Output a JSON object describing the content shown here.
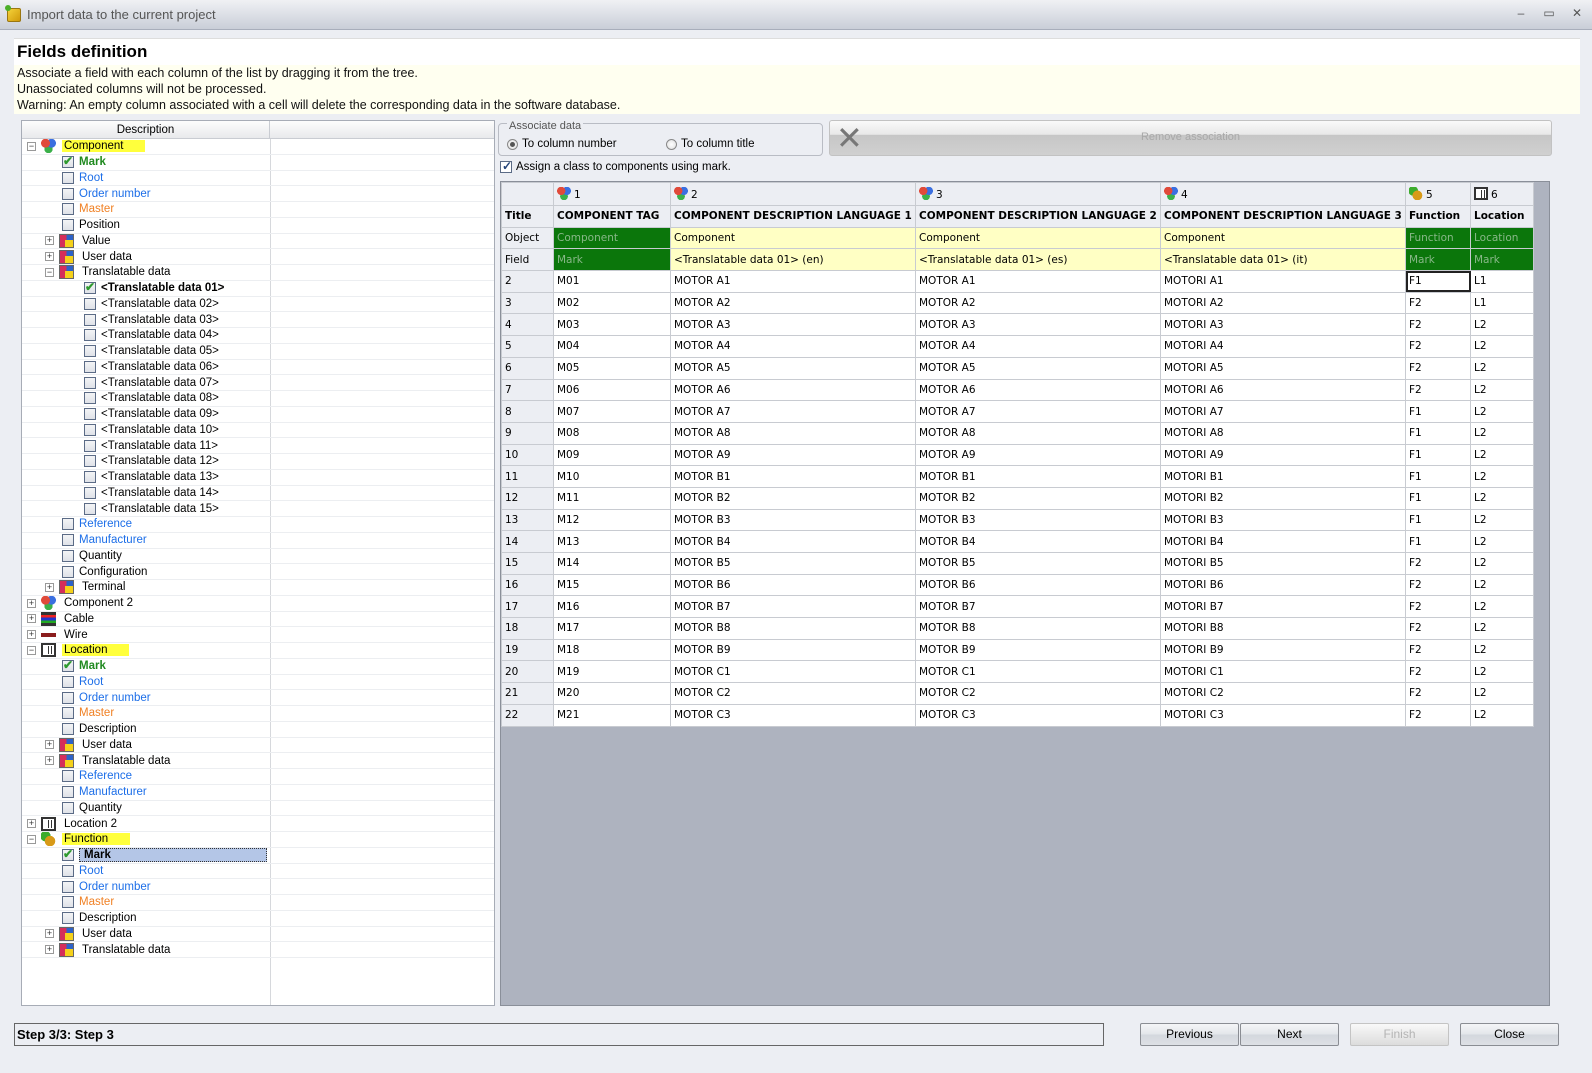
{
  "window": {
    "title": "Import data to the current project",
    "controls": {
      "minimize": "–",
      "maximize": "▭",
      "close": "✕"
    }
  },
  "header": {
    "title": "Fields definition",
    "lines": [
      "Associate a field with each column of the list by dragging it from the tree.",
      "Unassociated columns will not be processed.",
      "Warning: An empty column associated with a cell will delete the corresponding data in the software database."
    ]
  },
  "tree": {
    "column_header": "Description",
    "nodes": [
      {
        "label": "Component",
        "level": 0,
        "icon": "component-icon",
        "expander": "minus",
        "highlight": true
      },
      {
        "label": "Mark",
        "level": 1,
        "checkbox": true,
        "checked": true,
        "style": "greenb"
      },
      {
        "label": "Root",
        "level": 1,
        "checkbox": true,
        "style": "blue"
      },
      {
        "label": "Order number",
        "level": 1,
        "checkbox": true,
        "style": "blue"
      },
      {
        "label": "Master",
        "level": 1,
        "checkbox": true,
        "style": "orange"
      },
      {
        "label": "Position",
        "level": 1,
        "checkbox": true
      },
      {
        "label": "Value",
        "level": 1,
        "icon": "data-icon",
        "expander": "plus"
      },
      {
        "label": "User data",
        "level": 1,
        "icon": "data-icon",
        "expander": "plus"
      },
      {
        "label": "Translatable data",
        "level": 1,
        "icon": "data-icon",
        "expander": "minus"
      },
      {
        "label": "<Translatable data 01>",
        "level": 2,
        "checkbox": true,
        "checked": true,
        "style": "bold"
      },
      {
        "label": "<Translatable data 02>",
        "level": 2,
        "checkbox": true
      },
      {
        "label": "<Translatable data 03>",
        "level": 2,
        "checkbox": true
      },
      {
        "label": "<Translatable data 04>",
        "level": 2,
        "checkbox": true
      },
      {
        "label": "<Translatable data 05>",
        "level": 2,
        "checkbox": true
      },
      {
        "label": "<Translatable data 06>",
        "level": 2,
        "checkbox": true
      },
      {
        "label": "<Translatable data 07>",
        "level": 2,
        "checkbox": true
      },
      {
        "label": "<Translatable data 08>",
        "level": 2,
        "checkbox": true
      },
      {
        "label": "<Translatable data 09>",
        "level": 2,
        "checkbox": true
      },
      {
        "label": "<Translatable data 10>",
        "level": 2,
        "checkbox": true
      },
      {
        "label": "<Translatable data 11>",
        "level": 2,
        "checkbox": true
      },
      {
        "label": "<Translatable data 12>",
        "level": 2,
        "checkbox": true
      },
      {
        "label": "<Translatable data 13>",
        "level": 2,
        "checkbox": true
      },
      {
        "label": "<Translatable data 14>",
        "level": 2,
        "checkbox": true
      },
      {
        "label": "<Translatable data 15>",
        "level": 2,
        "checkbox": true
      },
      {
        "label": "Reference",
        "level": 1,
        "checkbox": true,
        "style": "blue"
      },
      {
        "label": "Manufacturer",
        "level": 1,
        "checkbox": true,
        "style": "blue"
      },
      {
        "label": "Quantity",
        "level": 1,
        "checkbox": true
      },
      {
        "label": "Configuration",
        "level": 1,
        "checkbox": true
      },
      {
        "label": "Terminal",
        "level": 1,
        "icon": "data-icon",
        "expander": "plus"
      },
      {
        "label": "Component 2",
        "level": 0,
        "icon": "component-icon",
        "expander": "plus"
      },
      {
        "label": "Cable",
        "level": 0,
        "icon": "cable-icon",
        "expander": "plus"
      },
      {
        "label": "Wire",
        "level": 0,
        "icon": "wire-icon",
        "expander": "plus"
      },
      {
        "label": "Location",
        "level": 0,
        "icon": "location-icon",
        "expander": "minus",
        "highlight": true
      },
      {
        "label": "Mark",
        "level": 1,
        "checkbox": true,
        "checked": true,
        "style": "greenb"
      },
      {
        "label": "Root",
        "level": 1,
        "checkbox": true,
        "style": "blue"
      },
      {
        "label": "Order number",
        "level": 1,
        "checkbox": true,
        "style": "blue"
      },
      {
        "label": "Master",
        "level": 1,
        "checkbox": true,
        "style": "orange"
      },
      {
        "label": "Description",
        "level": 1,
        "checkbox": true
      },
      {
        "label": "User data",
        "level": 1,
        "icon": "data-icon",
        "expander": "plus"
      },
      {
        "label": "Translatable data",
        "level": 1,
        "icon": "data-icon",
        "expander": "plus"
      },
      {
        "label": "Reference",
        "level": 1,
        "checkbox": true,
        "style": "blue"
      },
      {
        "label": "Manufacturer",
        "level": 1,
        "checkbox": true,
        "style": "blue"
      },
      {
        "label": "Quantity",
        "level": 1,
        "checkbox": true
      },
      {
        "label": "Location 2",
        "level": 0,
        "icon": "location-icon",
        "expander": "plus"
      },
      {
        "label": "Function",
        "level": 0,
        "icon": "function-icon",
        "expander": "minus",
        "highlight": true
      },
      {
        "label": "Mark",
        "level": 1,
        "checkbox": true,
        "checked": true,
        "style": "bold",
        "selected": true
      },
      {
        "label": "Root",
        "level": 1,
        "checkbox": true,
        "style": "blue"
      },
      {
        "label": "Order number",
        "level": 1,
        "checkbox": true,
        "style": "blue"
      },
      {
        "label": "Master",
        "level": 1,
        "checkbox": true,
        "style": "orange"
      },
      {
        "label": "Description",
        "level": 1,
        "checkbox": true
      },
      {
        "label": "User data",
        "level": 1,
        "icon": "data-icon",
        "expander": "plus"
      },
      {
        "label": "Translatable data",
        "level": 1,
        "icon": "data-icon",
        "expander": "plus"
      }
    ]
  },
  "associate": {
    "legend": "Associate data",
    "option_number": "To column number",
    "option_title": "To column title",
    "selected": "number"
  },
  "remove_association": {
    "label": "Remove association",
    "enabled": false
  },
  "assign_class": {
    "label": "Assign a class to components using mark.",
    "checked": true
  },
  "grid": {
    "row_labels": {
      "title": "Title",
      "object": "Object",
      "field": "Field"
    },
    "columns": [
      {
        "number": "1",
        "icon": "component-icon",
        "title": "COMPONENT TAG",
        "object": "Component",
        "field": "Mark",
        "assoc": "green"
      },
      {
        "number": "2",
        "icon": "component-icon",
        "title": "COMPONENT DESCRIPTION LANGUAGE 1",
        "object": "Component",
        "field": "<Translatable data 01> (en)",
        "assoc": "yellow"
      },
      {
        "number": "3",
        "icon": "component-icon",
        "title": "COMPONENT DESCRIPTION LANGUAGE 2",
        "object": "Component",
        "field": "<Translatable data 01> (es)",
        "assoc": "yellow"
      },
      {
        "number": "4",
        "icon": "component-icon",
        "title": "COMPONENT DESCRIPTION LANGUAGE 3",
        "object": "Component",
        "field": "<Translatable data 01> (it)",
        "assoc": "yellow"
      },
      {
        "number": "5",
        "icon": "function-icon",
        "title": "Function",
        "object": "Function",
        "field": "Mark",
        "assoc": "green"
      },
      {
        "number": "6",
        "icon": "location-icon",
        "title": "Location",
        "object": "Location",
        "field": "Mark",
        "assoc": "green"
      }
    ],
    "rows": [
      [
        "2",
        "M01",
        "MOTOR A1",
        "MOTOR A1",
        "MOTORI A1",
        "F1",
        "L1"
      ],
      [
        "3",
        "M02",
        "MOTOR A2",
        "MOTOR A2",
        "MOTORI A2",
        "F2",
        "L1"
      ],
      [
        "4",
        "M03",
        "MOTOR A3",
        "MOTOR A3",
        "MOTORI A3",
        "F2",
        "L2"
      ],
      [
        "5",
        "M04",
        "MOTOR A4",
        "MOTOR A4",
        "MOTORI A4",
        "F2",
        "L2"
      ],
      [
        "6",
        "M05",
        "MOTOR A5",
        "MOTOR A5",
        "MOTORI A5",
        "F2",
        "L2"
      ],
      [
        "7",
        "M06",
        "MOTOR A6",
        "MOTOR A6",
        "MOTORI A6",
        "F2",
        "L2"
      ],
      [
        "8",
        "M07",
        "MOTOR A7",
        "MOTOR A7",
        "MOTORI A7",
        "F1",
        "L2"
      ],
      [
        "9",
        "M08",
        "MOTOR A8",
        "MOTOR A8",
        "MOTORI A8",
        "F1",
        "L2"
      ],
      [
        "10",
        "M09",
        "MOTOR A9",
        "MOTOR A9",
        "MOTORI A9",
        "F1",
        "L2"
      ],
      [
        "11",
        "M10",
        "MOTOR B1",
        "MOTOR B1",
        "MOTORI B1",
        "F1",
        "L2"
      ],
      [
        "12",
        "M11",
        "MOTOR B2",
        "MOTOR B2",
        "MOTORI B2",
        "F1",
        "L2"
      ],
      [
        "13",
        "M12",
        "MOTOR B3",
        "MOTOR B3",
        "MOTORI B3",
        "F1",
        "L2"
      ],
      [
        "14",
        "M13",
        "MOTOR B4",
        "MOTOR B4",
        "MOTORI B4",
        "F1",
        "L2"
      ],
      [
        "15",
        "M14",
        "MOTOR B5",
        "MOTOR B5",
        "MOTORI B5",
        "F2",
        "L2"
      ],
      [
        "16",
        "M15",
        "MOTOR B6",
        "MOTOR B6",
        "MOTORI B6",
        "F2",
        "L2"
      ],
      [
        "17",
        "M16",
        "MOTOR B7",
        "MOTOR B7",
        "MOTORI B7",
        "F2",
        "L2"
      ],
      [
        "18",
        "M17",
        "MOTOR B8",
        "MOTOR B8",
        "MOTORI B8",
        "F2",
        "L2"
      ],
      [
        "19",
        "M18",
        "MOTOR B9",
        "MOTOR B9",
        "MOTORI B9",
        "F2",
        "L2"
      ],
      [
        "20",
        "M19",
        "MOTOR C1",
        "MOTOR C1",
        "MOTORI C1",
        "F2",
        "L2"
      ],
      [
        "21",
        "M20",
        "MOTOR C2",
        "MOTOR C2",
        "MOTORI C2",
        "F2",
        "L2"
      ],
      [
        "22",
        "M21",
        "MOTOR C3",
        "MOTOR C3",
        "MOTORI C3",
        "F2",
        "L2"
      ]
    ],
    "focused_cell": {
      "row": 0,
      "col": 5
    },
    "colors": {
      "associated": "#0b760b",
      "pending": "#ffffc4"
    }
  },
  "footer": {
    "step": "Step 3/3: Step 3",
    "previous": "Previous",
    "next": "Next",
    "finish": "Finish",
    "finish_enabled": false,
    "close": "Close"
  }
}
